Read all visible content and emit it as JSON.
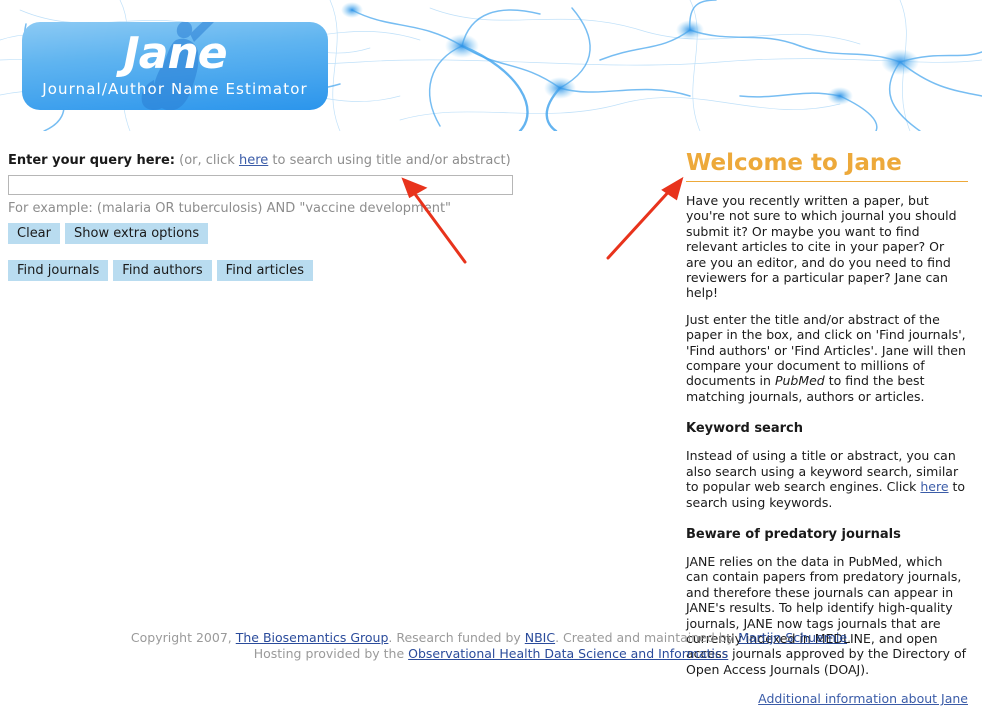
{
  "banner": {
    "logo_title": "Jane",
    "logo_subtitle": "Journal/Author  Name  Estimator",
    "silhouette_icon": "person-silhouette-icon",
    "neuron_background_icon": "neuron-network-icon"
  },
  "query": {
    "label_strong": "Enter your query here:",
    "label_hint_before": "(or, click ",
    "label_hint_link": "here",
    "label_hint_after": " to search using title and/or abstract)",
    "input_value": "",
    "input_placeholder": "",
    "example_text": "For example: (malaria OR tuberculosis) AND \"vaccine development\"",
    "buttons_row1": [
      {
        "label": "Clear",
        "name": "clear-button"
      },
      {
        "label": "Show extra options",
        "name": "show-extra-options-button"
      }
    ],
    "buttons_row2": [
      {
        "label": "Find journals",
        "name": "find-journals-button"
      },
      {
        "label": "Find authors",
        "name": "find-authors-button"
      },
      {
        "label": "Find articles",
        "name": "find-articles-button"
      }
    ]
  },
  "welcome": {
    "title": "Welcome to Jane",
    "paragraph1": "Have you recently written a paper, but you're not sure to which journal you should submit it? Or maybe you want to find relevant articles to cite in your paper? Or are you an editor, and do you need to find reviewers for a particular paper? Jane can help!",
    "paragraph2_part1": "Just enter the title and/or abstract of the paper in the box, and click on 'Find journals', 'Find authors' or 'Find Articles'. Jane will then compare your document to millions of documents in ",
    "paragraph2_italic": "PubMed",
    "paragraph2_part2": " to find the best matching journals, authors or articles.",
    "keyword_heading": "Keyword search",
    "keyword_part1": "Instead of using a title or abstract, you can also search using a keyword search, similar to popular web search engines. Click ",
    "keyword_link": "here",
    "keyword_part2": " to search using keywords.",
    "predatory_heading": "Beware of predatory journals",
    "predatory_text": "JANE relies on the data in PubMed, which can contain papers from predatory journals, and therefore these journals can appear in JANE's results. To help identify high-quality journals, JANE now tags journals that are currently indexed in MEDLINE, and open access journals approved by the Directory of Open Access Journals (DOAJ).",
    "additional_link": "Additional information about Jane"
  },
  "footer": {
    "line1_part1": "Copyright 2007, ",
    "line1_link1": "The Biosemantics Group",
    "line1_part2": ". Research funded by ",
    "line1_link2": "NBIC",
    "line1_part3": ". Created and maintained by ",
    "line1_link3": "Martijn Schuemie",
    "line1_part4": ".",
    "line2_part1": "Hosting provided by the ",
    "line2_link1": "Observational Health Data Science and Informatics"
  },
  "annotations": {
    "arrow_color": "#e8331c",
    "arrow1_target": "query-input",
    "arrow2_target": "welcome-title"
  }
}
